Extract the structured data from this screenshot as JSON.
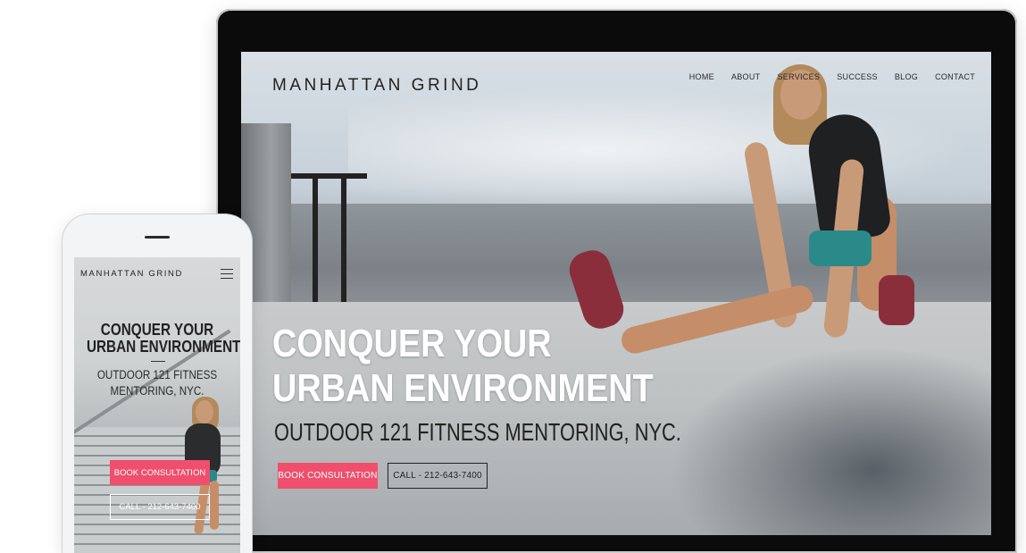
{
  "brand": "MANHATTAN GRIND",
  "desktop": {
    "nav": [
      "HOME",
      "ABOUT",
      "SERVICES",
      "SUCCESS",
      "BLOG",
      "CONTACT"
    ],
    "headline_line1": "CONQUER YOUR",
    "headline_line2": "URBAN ENVIRONMENT",
    "subheadline": "OUTDOOR 121 FITNESS MENTORING, NYC.",
    "book_button": "BOOK CONSULTATION",
    "call_button": "CALL - 212-643-7400"
  },
  "mobile": {
    "headline_line1": "CONQUER YOUR",
    "headline_line2": "URBAN ENVIRONMENT",
    "sub_line1": "OUTDOOR 121 FITNESS",
    "sub_line2": "MENTORING, NYC.",
    "book_button": "BOOK CONSULTATION",
    "call_button": "CALL - 212-643-7400",
    "menu_icon": "hamburger-menu-icon"
  },
  "colors": {
    "accent": "#ef4f6d",
    "text_dark": "#222222",
    "device_frame": "#0b0b0b"
  }
}
